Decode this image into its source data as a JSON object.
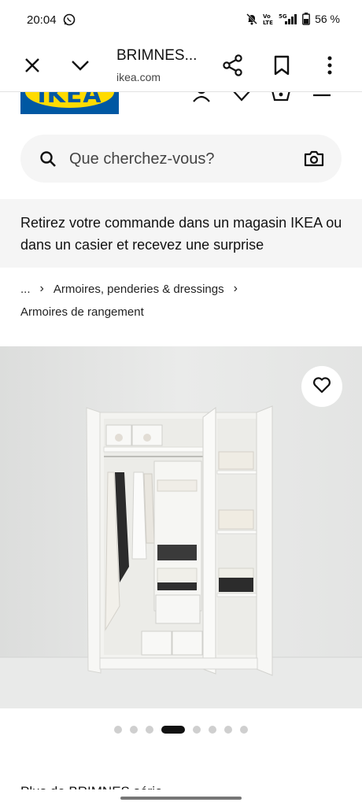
{
  "status_bar": {
    "time": "20:04",
    "battery": "56 %",
    "icons": [
      "whatsapp-icon",
      "mute-icon",
      "volte-icon",
      "5g-signal-icon",
      "battery-icon"
    ]
  },
  "tab_bar": {
    "title": "BRIMNES...",
    "url": "ikea.com",
    "icons": [
      "close-icon",
      "chevron-down-icon",
      "share-icon",
      "bookmark-icon",
      "more-icon"
    ]
  },
  "header": {
    "logo_text": "IKEA",
    "icons": [
      "account-icon",
      "heart-icon",
      "basket-icon",
      "menu-icon"
    ]
  },
  "search": {
    "placeholder": "Que cherchez-vous?",
    "icons": [
      "search-icon",
      "camera-icon"
    ]
  },
  "promo": {
    "text": "Retirez votre commande dans un magasin IKEA ou dans un casier et recevez une surprise"
  },
  "breadcrumb": {
    "ellipsis": "...",
    "separator": "›",
    "item1": "Armoires, penderies & dressings",
    "item2": "Armoires de rangement"
  },
  "product": {
    "image_alt": "Armoire BRIMNES blanche",
    "carousel": {
      "total": 8,
      "active": 4
    }
  },
  "teaser_text": "Plus de BRIMNES série",
  "colors": {
    "ikea_blue": "#0058a3",
    "ikea_yellow": "#ffdb00",
    "search_bg": "#f5f5f5",
    "dot_inactive": "#cfcfcf",
    "dot_active": "#111111"
  }
}
